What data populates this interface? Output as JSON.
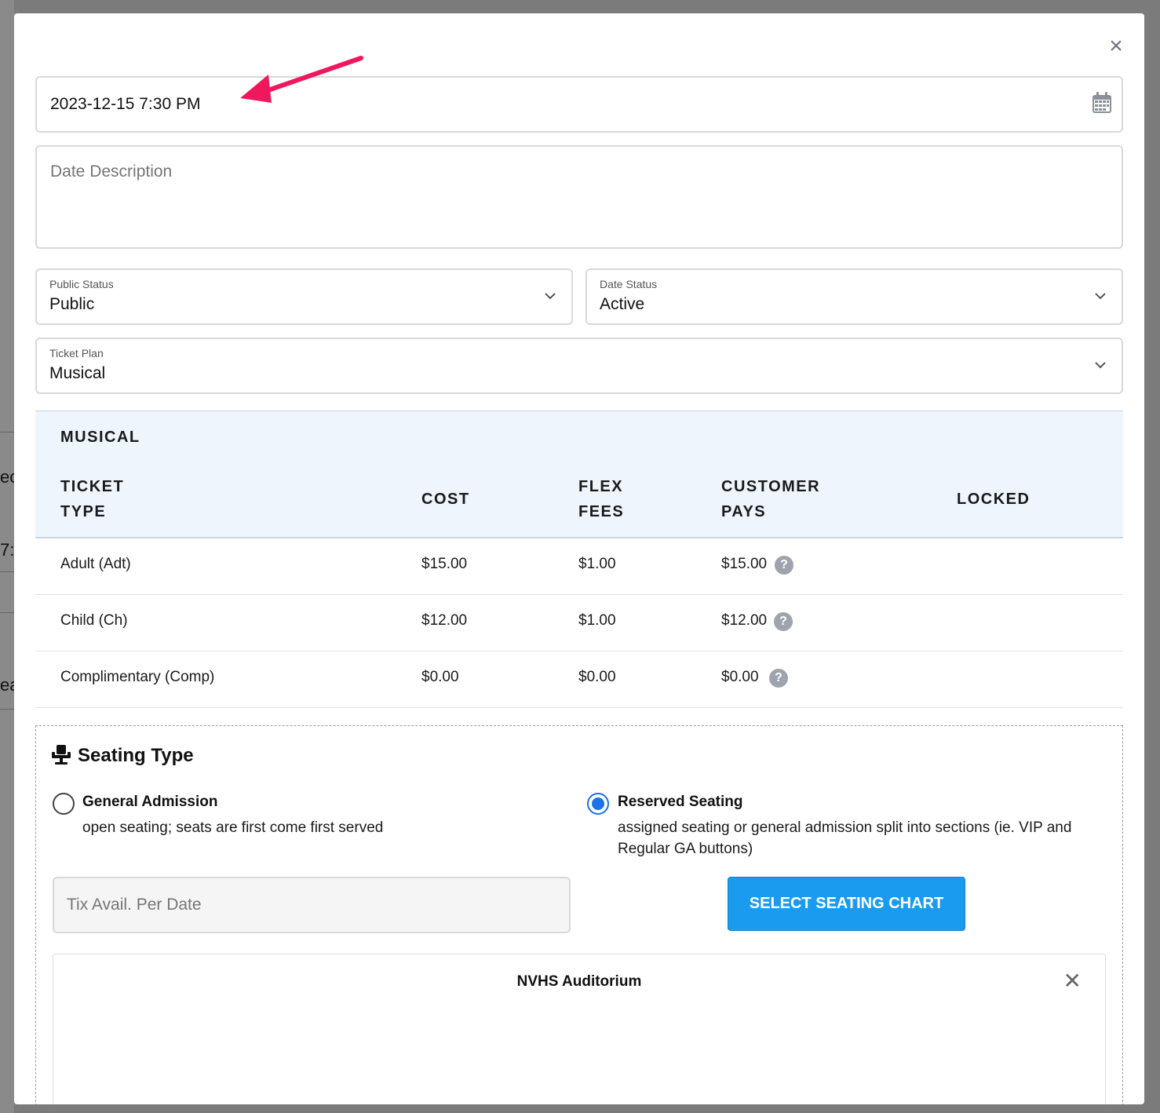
{
  "background": {
    "fragments": [
      "ec",
      "7:",
      "ea"
    ]
  },
  "modal": {
    "close_icon": "close-icon",
    "date_field": {
      "value": "2023-12-15 7:30 PM",
      "icon": "calendar-icon"
    },
    "annotation": {
      "icon": "arrow-icon",
      "color": "#f0185c"
    },
    "date_description": {
      "placeholder": "Date Description"
    },
    "public_status": {
      "label": "Public Status",
      "value": "Public"
    },
    "date_status": {
      "label": "Date Status",
      "value": "Active"
    },
    "ticket_plan": {
      "label": "Ticket Plan",
      "value": "Musical"
    },
    "plan_table": {
      "title": "MUSICAL",
      "headers": {
        "ticket_type_1": "TICKET",
        "ticket_type_2": "TYPE",
        "cost": "COST",
        "flex_fees_1": "FLEX",
        "flex_fees_2": "FEES",
        "customer_pays_1": "CUSTOMER",
        "customer_pays_2": "PAYS",
        "locked": "LOCKED"
      },
      "rows": [
        {
          "ticket_type": "Adult (Adt)",
          "cost": "$15.00",
          "flex_fees": "$1.00",
          "customer_pays": "$15.00",
          "locked": ""
        },
        {
          "ticket_type": "Child (Ch)",
          "cost": "$12.00",
          "flex_fees": "$1.00",
          "customer_pays": "$12.00",
          "locked": ""
        },
        {
          "ticket_type": "Complimentary (Comp)",
          "cost": "$0.00",
          "flex_fees": "$0.00",
          "customer_pays": "$0.00",
          "locked": ""
        }
      ],
      "help_glyph": "?"
    },
    "seating": {
      "icon": "seat-icon",
      "title": "Seating Type",
      "general": {
        "title": "General Admission",
        "desc": "open seating; seats are first come first served",
        "selected": false
      },
      "reserved": {
        "title": "Reserved Seating",
        "desc": "assigned seating or general admission split into sections (ie. VIP and Regular GA buttons)",
        "selected": true
      },
      "tix_avail": {
        "placeholder": "Tix Avail. Per Date"
      },
      "select_chart_label": "SELECT SEATING CHART",
      "venue": {
        "name": "NVHS Auditorium",
        "close_glyph": "✕"
      }
    },
    "colors": {
      "accent": "#1a9bef",
      "radio": "#1a73e8",
      "table_header_bg": "#eff5fd"
    }
  }
}
